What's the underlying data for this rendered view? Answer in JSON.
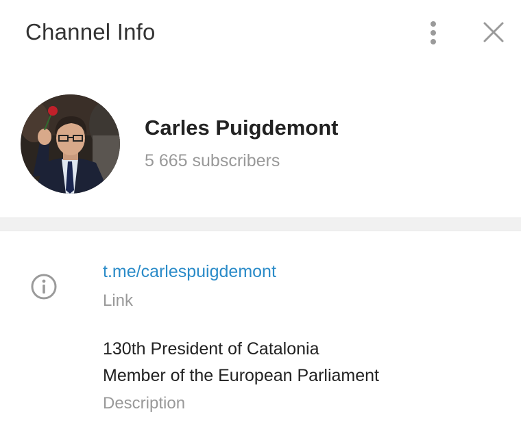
{
  "header": {
    "title": "Channel Info",
    "more_icon": "vertical-ellipsis-icon",
    "close_icon": "close-icon"
  },
  "profile": {
    "name": "Carles Puigdemont",
    "subscribers": "5 665 subscribers",
    "avatar": "channel-avatar-photo"
  },
  "info": {
    "icon": "info-circle-icon",
    "link": {
      "value": "t.me/carlespuigdemont",
      "label": "Link"
    },
    "description": {
      "lines": [
        "130th President of Catalonia",
        "Member of the European Parliament"
      ],
      "label": "Description"
    }
  },
  "colors": {
    "link": "#2a8bc8",
    "secondary_text": "#999999",
    "primary_text": "#222222",
    "icon": "#9a9a9a"
  }
}
